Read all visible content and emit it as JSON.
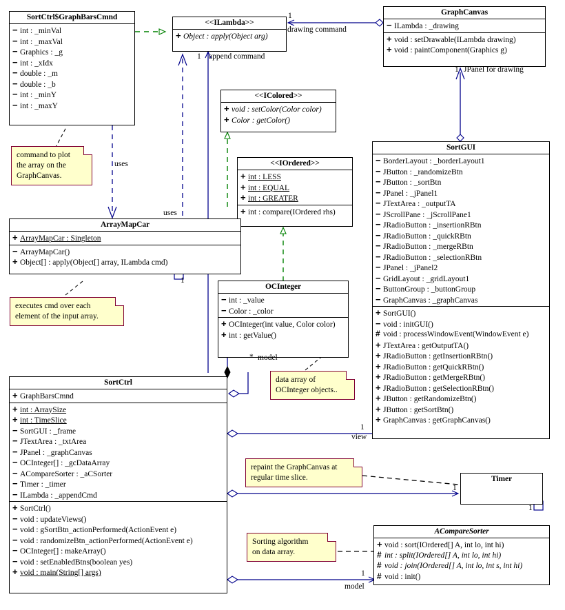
{
  "diagram": {
    "title": "Sort Visualizer UML Class Diagram",
    "colors": {
      "line_blue": "#00008b",
      "line_green": "#008000",
      "line_black": "#000000",
      "note_fill": "#ffffcc",
      "note_border": "#800033"
    }
  },
  "classes": {
    "graphBarsCmnd": {
      "name": "SortCtrl$GraphBarsCmnd",
      "attributes": [
        {
          "vis": "-",
          "text": "int : _minVal"
        },
        {
          "vis": "-",
          "text": "int : _maxVal"
        },
        {
          "vis": "-",
          "text": "Graphics : _g"
        },
        {
          "vis": "-",
          "text": "int : _xIdx"
        },
        {
          "vis": "-",
          "text": "double : _m"
        },
        {
          "vis": "-",
          "text": "double : _b"
        },
        {
          "vis": "-",
          "text": "int : _minY"
        },
        {
          "vis": "-",
          "text": "int : _maxY"
        }
      ]
    },
    "iLambda": {
      "name": "<<ILambda>>",
      "methods": [
        {
          "vis": "+",
          "text": "Object : apply(Object arg)",
          "italic": true
        }
      ]
    },
    "graphCanvas": {
      "name": "GraphCanvas",
      "attributes": [
        {
          "vis": "-",
          "text": "ILambda : _drawing"
        }
      ],
      "methods": [
        {
          "vis": "+",
          "text": "void : setDrawable(ILambda drawing)"
        },
        {
          "vis": "+",
          "text": "void : paintComponent(Graphics g)"
        }
      ]
    },
    "iColored": {
      "name": "<<IColored>>",
      "methods": [
        {
          "vis": "+",
          "text": "void : setColor(Color color)",
          "italic": true
        },
        {
          "vis": "+",
          "text": "Color : getColor()",
          "italic": true
        }
      ]
    },
    "iOrdered": {
      "name": "<<IOrdered>>",
      "constants": [
        {
          "vis": "+",
          "text": "int : LESS",
          "static": true
        },
        {
          "vis": "+",
          "text": "int : EQUAL",
          "static": true
        },
        {
          "vis": "+",
          "text": "int : GREATER",
          "static": true
        }
      ],
      "methods": [
        {
          "vis": "+",
          "text": "int : compare(IOrdered rhs)"
        }
      ]
    },
    "arrayMapCar": {
      "name": "ArrayMapCar",
      "attributes": [
        {
          "vis": "+",
          "text": "ArrayMapCar : Singleton",
          "static": true
        }
      ],
      "methods": [
        {
          "vis": "-",
          "text": "ArrayMapCar()"
        },
        {
          "vis": "+",
          "text": "Object[] : apply(Object[] array, ILambda cmd)"
        }
      ]
    },
    "ocInteger": {
      "name": "OCInteger",
      "attributes": [
        {
          "vis": "-",
          "text": "int : _value"
        },
        {
          "vis": "-",
          "text": "Color : _color"
        }
      ],
      "methods": [
        {
          "vis": "+",
          "text": "OCInteger(int value, Color color)"
        },
        {
          "vis": "+",
          "text": "int : getValue()"
        }
      ]
    },
    "sortGUI": {
      "name": "SortGUI",
      "attributes": [
        {
          "vis": "-",
          "text": "BorderLayout : _borderLayout1"
        },
        {
          "vis": "-",
          "text": "JButton : _randomizeBtn"
        },
        {
          "vis": "-",
          "text": "JButton : _sortBtn"
        },
        {
          "vis": "-",
          "text": "JPanel : _jPanel1"
        },
        {
          "vis": "-",
          "text": "JTextArea : _outputTA"
        },
        {
          "vis": "-",
          "text": "JScrollPane : _jScrollPane1"
        },
        {
          "vis": "-",
          "text": "JRadioButton : _insertionRBtn"
        },
        {
          "vis": "-",
          "text": "JRadioButton : _quickRBtn"
        },
        {
          "vis": "-",
          "text": "JRadioButton : _mergeRBtn"
        },
        {
          "vis": "-",
          "text": "JRadioButton : _selectionRBtn"
        },
        {
          "vis": "-",
          "text": "JPanel : _jPanel2"
        },
        {
          "vis": "-",
          "text": "GridLayout : _gridLayout1"
        },
        {
          "vis": "-",
          "text": "ButtonGroup : _buttonGroup"
        },
        {
          "vis": "-",
          "text": "GraphCanvas : _graphCanvas"
        }
      ],
      "methods": [
        {
          "vis": "+",
          "text": "SortGUI()"
        },
        {
          "vis": "-",
          "text": "void : initGUI()"
        },
        {
          "vis": "#",
          "text": "void : processWindowEvent(WindowEvent e)"
        },
        {
          "vis": "+",
          "text": "JTextArea : getOutputTA()"
        },
        {
          "vis": "+",
          "text": "JRadioButton : getInsertionRBtn()"
        },
        {
          "vis": "+",
          "text": "JRadioButton : getQuickRBtn()"
        },
        {
          "vis": "+",
          "text": "JRadioButton : getMergeRBtn()"
        },
        {
          "vis": "+",
          "text": "JRadioButton : getSelectionRBtn()"
        },
        {
          "vis": "+",
          "text": "JButton : getRandomizeBtn()"
        },
        {
          "vis": "+",
          "text": "JButton : getSortBtn()"
        },
        {
          "vis": "+",
          "text": "GraphCanvas : getGraphCanvas()"
        }
      ]
    },
    "sortCtrl": {
      "name": "SortCtrl",
      "inner": [
        {
          "vis": "+",
          "text": "GraphBarsCmnd"
        }
      ],
      "attributes": [
        {
          "vis": "+",
          "text": "int : ArraySize",
          "static": true
        },
        {
          "vis": "+",
          "text": "int : TimeSlice",
          "static": true
        },
        {
          "vis": "-",
          "text": "SortGUI : _frame"
        },
        {
          "vis": "-",
          "text": "JTextArea : _txtArea"
        },
        {
          "vis": "-",
          "text": "JPanel : _graphCanvas"
        },
        {
          "vis": "-",
          "text": "OCInteger[] : _gcDataArray"
        },
        {
          "vis": "-",
          "text": "ACompareSorter : _aCSorter"
        },
        {
          "vis": "-",
          "text": "Timer : _timer"
        },
        {
          "vis": "-",
          "text": "ILambda : _appendCmd"
        }
      ],
      "methods": [
        {
          "vis": "+",
          "text": "SortCtrl()"
        },
        {
          "vis": "-",
          "text": "void : updateViews()"
        },
        {
          "vis": "-",
          "text": "void : gSortBtn_actionPerformed(ActionEvent e)"
        },
        {
          "vis": "-",
          "text": "void : randomizeBtn_actionPerformed(ActionEvent e)"
        },
        {
          "vis": "-",
          "text": "OCInteger[] : makeArray()"
        },
        {
          "vis": "-",
          "text": "void : setEnabledBtns(boolean yes)"
        },
        {
          "vis": "+",
          "text": "void : main(String[] args)",
          "static": true
        }
      ]
    },
    "timer": {
      "name": "Timer"
    },
    "aCompareSorter": {
      "name": "ACompareSorter",
      "methods": [
        {
          "vis": "+",
          "text": "void : sort(IOrdered[] A, int lo, int hi)"
        },
        {
          "vis": "#",
          "text": "int : split(IOrdered[] A, int lo, int hi)",
          "italic": true
        },
        {
          "vis": "#",
          "text": "void : join(IOrdered[] A, int lo, int s, int hi)",
          "italic": true
        },
        {
          "vis": "#",
          "text": "void : init()"
        }
      ]
    }
  },
  "notes": {
    "plotNote": {
      "lines": [
        "command to plot",
        "the array on the",
        "GraphCanvas."
      ]
    },
    "executesNote": {
      "lines": [
        "executes cmd over each",
        "element of the input array."
      ]
    },
    "dataArrayNote": {
      "lines": [
        "data array of",
        "OCInteger objects.."
      ]
    },
    "repaintNote": {
      "lines": [
        "repaint the GraphCanvas at",
        "regular time slice."
      ]
    },
    "sortingNote": {
      "lines": [
        "Sorting algorithm",
        "on data array."
      ]
    }
  },
  "edge_labels": {
    "drawing_command": "drawing command",
    "drawing_command_mult": "1",
    "append_command": "append command",
    "append_command_mult": "1",
    "jpanel_for_drawing": "JPanel for drawing",
    "jpanel_mult": "1",
    "uses_left": "uses",
    "uses_right": "uses",
    "arraymapcar_mult": "1",
    "model_star": "*",
    "model_label": "model",
    "view_label": "view",
    "view_mult": "1",
    "timer_mult_left": "1",
    "timer_mult_right": "1",
    "sorter_mult": "1",
    "sorter_model": "model"
  }
}
